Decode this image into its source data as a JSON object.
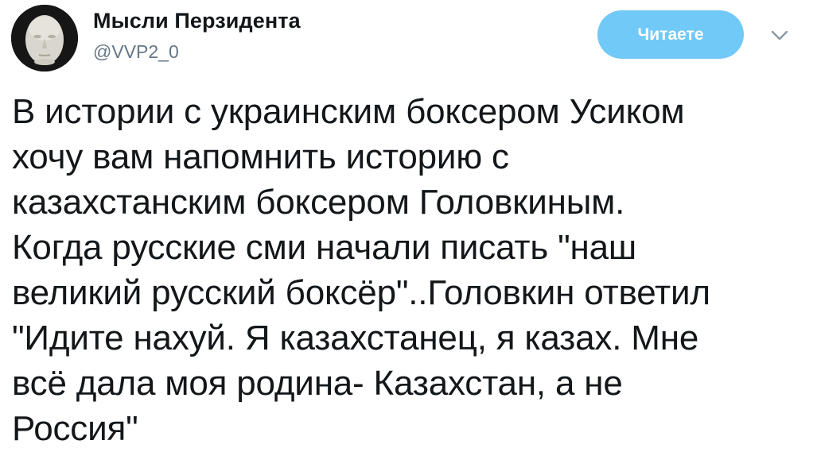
{
  "tweet": {
    "author": {
      "display_name": "Мысли Перзидента",
      "handle": "@VVP2_0",
      "avatar_icon": "plaster-mask-avatar"
    },
    "follow_button_label": "Читаете",
    "caret_icon": "chevron-down-icon",
    "text": "В истории с украинским боксером Усиком\nхочу вам напомнить историю с\nказахстанским боксером Головкиным.\nКогда русские сми начали писать \"наш\nвеликий русский боксёр\"..Головкин ответил\n\"Идите нахуй. Я казахстанец, я казах. Мне\nвсё дала моя родина- Казахстан, а не\nРоссия\""
  },
  "colors": {
    "follow_button_bg": "#71c9f8",
    "handle_text": "#657786",
    "body_text": "#14171a"
  }
}
